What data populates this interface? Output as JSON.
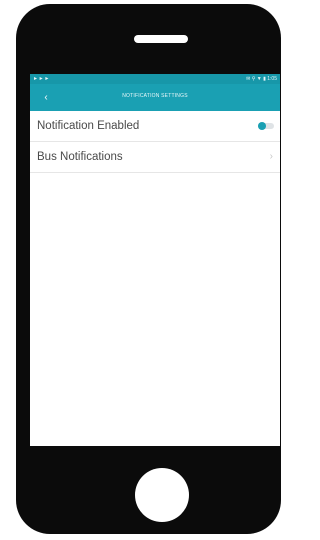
{
  "device": {
    "body_color": "#0b0b0b"
  },
  "status_bar": {
    "left_text": "▸ ▸ ▸",
    "right_text": "✉ ⚲ ▼ ▮ 1:05",
    "color": "#1797a9"
  },
  "app_bar": {
    "title": "NOTIFICATION SETTINGS",
    "back_icon": "chevron-left-icon",
    "back_glyph": "‹",
    "color": "#1aa0b3"
  },
  "settings": {
    "items": [
      {
        "label": "Notification Enabled",
        "control": "toggle",
        "enabled": true
      },
      {
        "label": "Bus Notifications",
        "control": "chevron",
        "glyph": "›"
      }
    ]
  },
  "colors": {
    "accent": "#1aa0b3"
  }
}
